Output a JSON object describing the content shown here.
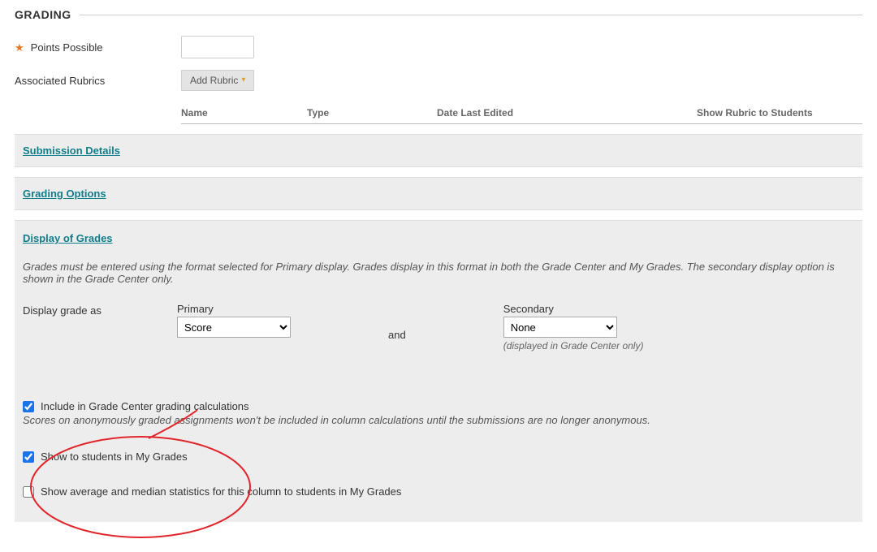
{
  "section_title": "GRADING",
  "points_possible": {
    "label": "Points Possible",
    "value": ""
  },
  "associated_rubrics": {
    "label": "Associated Rubrics",
    "button_label": "Add Rubric",
    "headers": {
      "name": "Name",
      "type": "Type",
      "date": "Date Last Edited",
      "show": "Show Rubric to Students"
    }
  },
  "links": {
    "submission_details": "Submission Details",
    "grading_options": "Grading Options",
    "display_of_grades": "Display of Grades"
  },
  "display": {
    "help": "Grades must be entered using the format selected for Primary display. Grades display in this format in both the Grade Center and My Grades. The secondary display option is shown in the Grade Center only.",
    "row_label": "Display grade as",
    "primary_label": "Primary",
    "primary_value": "Score",
    "and": "and",
    "secondary_label": "Secondary",
    "secondary_value": "None",
    "secondary_note": "(displayed in Grade Center only)"
  },
  "checkboxes": {
    "include_calc": {
      "label": "Include in Grade Center grading calculations",
      "note": "Scores on anonymously graded assignments won't be included in column calculations until the submissions are no longer anonymous.",
      "checked": true
    },
    "show_students": {
      "label": "Show to students in My Grades",
      "checked": true
    },
    "show_stats": {
      "label": "Show average and median statistics for this column to students in My Grades",
      "checked": false
    }
  }
}
